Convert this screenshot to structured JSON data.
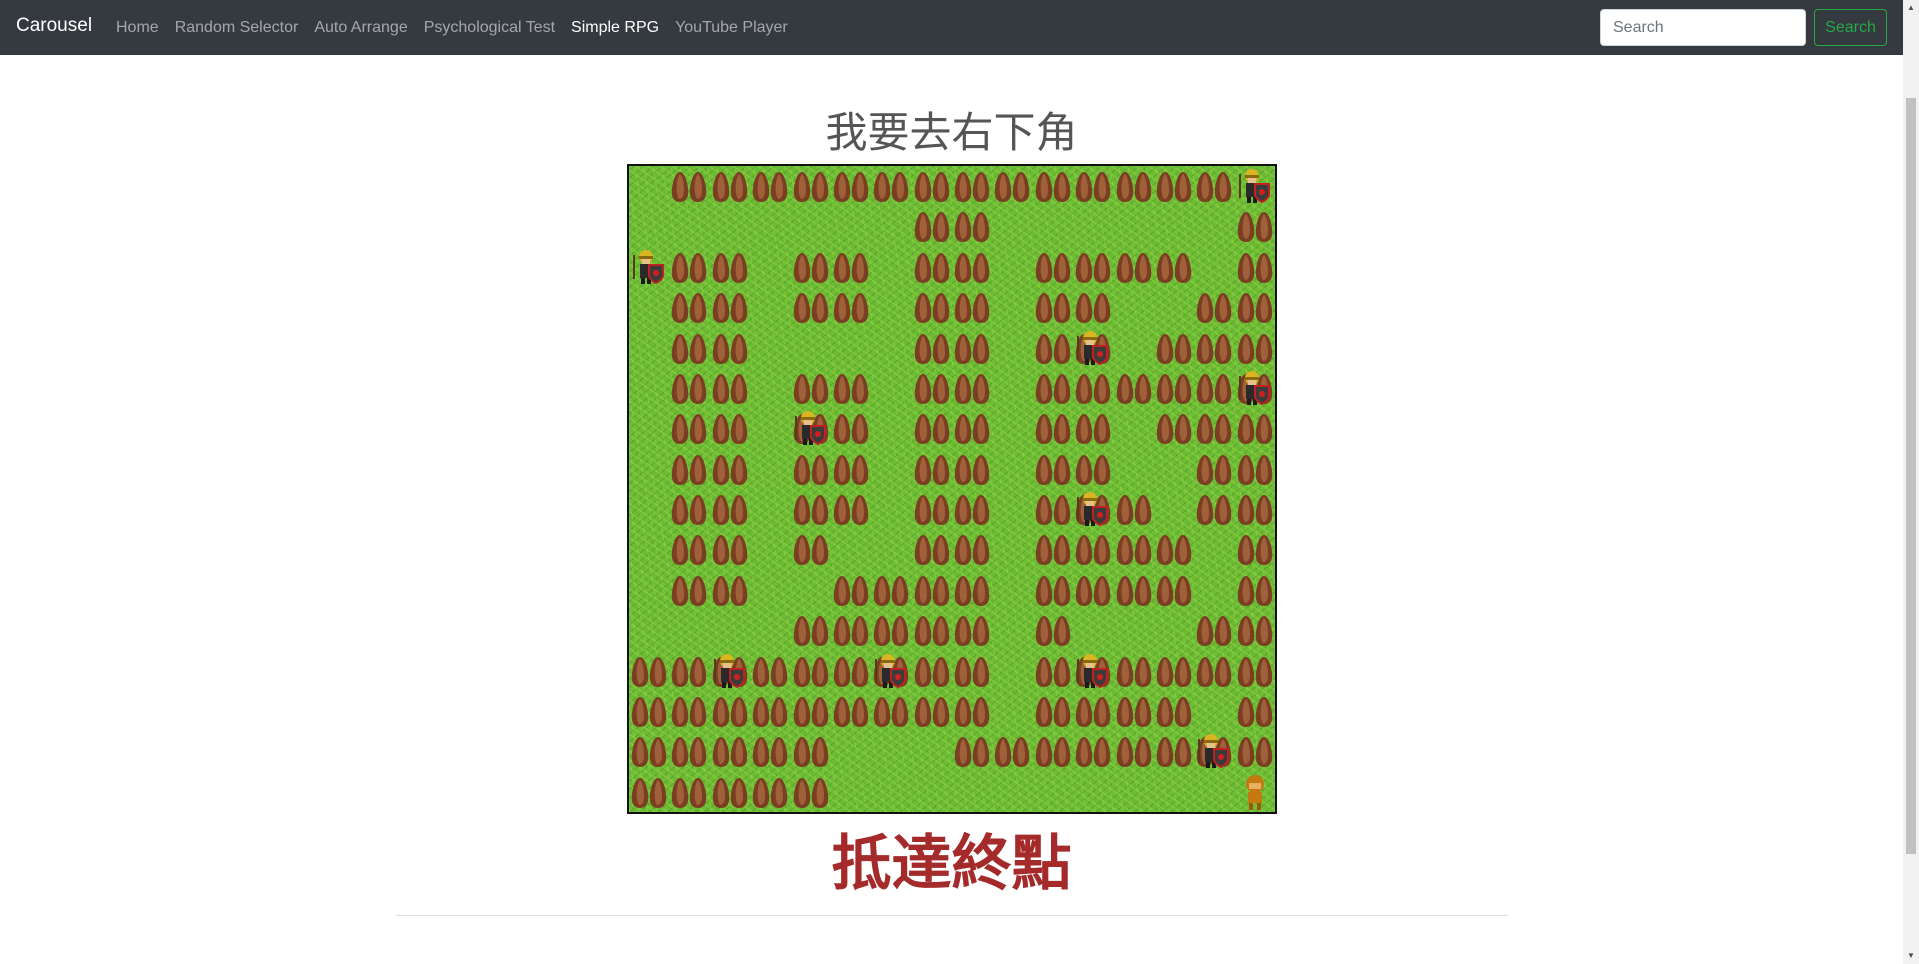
{
  "navbar": {
    "brand": "Carousel",
    "links": [
      {
        "label": "Home",
        "active": false
      },
      {
        "label": "Random Selector",
        "active": false
      },
      {
        "label": "Auto Arrange",
        "active": false
      },
      {
        "label": "Psychological Test",
        "active": false
      },
      {
        "label": "Simple RPG",
        "active": true
      },
      {
        "label": "YouTube Player",
        "active": false
      }
    ],
    "search_placeholder": "Search",
    "search_button": "Search"
  },
  "game": {
    "heading": "我要去右下角",
    "result": "抵達終點",
    "grid_size": 16,
    "trees": [
      "0111111111111110",
      "0000000110000001",
      "0110110110111101",
      "0110110110110011",
      "0110000110110111",
      "0110110110111111",
      "0110110110110111",
      "0110110110110011",
      "0110110110111011",
      "0110100110111101",
      "0110011110111101",
      "0000111110100011",
      "1111111110111111",
      "1111111110111101",
      "1111100011111111",
      "1111100000000000"
    ],
    "soldiers": [
      [
        0,
        15
      ],
      [
        2,
        0
      ],
      [
        4,
        11
      ],
      [
        5,
        15
      ],
      [
        6,
        4
      ],
      [
        8,
        11
      ],
      [
        12,
        2
      ],
      [
        12,
        6
      ],
      [
        12,
        11
      ],
      [
        14,
        14
      ]
    ],
    "player": [
      15,
      15
    ],
    "colors": {
      "grass": "#6dbb35",
      "tree": "#8b4a2b",
      "result": "#a52a2a",
      "accent": "#28a745"
    }
  }
}
